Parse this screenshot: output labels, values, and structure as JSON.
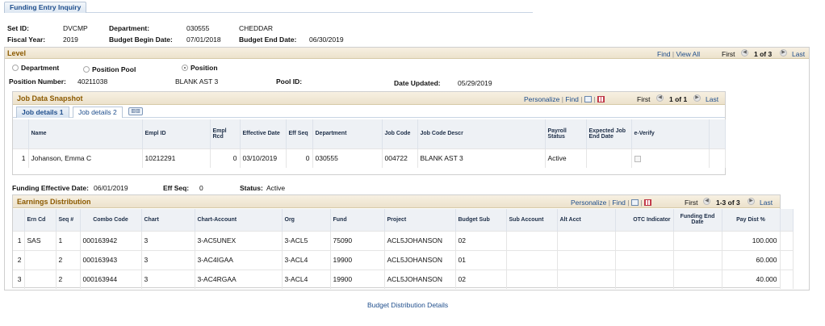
{
  "page_tab": "Funding Entry Inquiry",
  "header": {
    "set_id_label": "Set ID:",
    "set_id": "DVCMP",
    "department_label": "Department:",
    "department_code": "030555",
    "department_name": "CHEDDAR",
    "fiscal_year_label": "Fiscal Year:",
    "fiscal_year": "2019",
    "budget_begin_label": "Budget Begin Date:",
    "budget_begin": "07/01/2018",
    "budget_end_label": "Budget End Date:",
    "budget_end": "06/30/2019"
  },
  "level": {
    "title": "Level",
    "find": "Find",
    "view_all": "View All",
    "first": "First",
    "count": "1 of 3",
    "last": "Last",
    "radio_department": "Department",
    "radio_position_pool": "Position Pool",
    "radio_position": "Position",
    "position_number_label": "Position Number:",
    "position_number": "40211038",
    "position_title": "BLANK AST 3",
    "pool_id_label": "Pool ID:",
    "date_updated_label": "Date Updated:",
    "date_updated": "05/29/2019"
  },
  "job_snapshot": {
    "title": "Job Data Snapshot",
    "personalize": "Personalize",
    "find": "Find",
    "first": "First",
    "count": "1 of 1",
    "last": "Last",
    "tab1": "Job details 1",
    "tab2": "Job details 2",
    "columns": [
      "Name",
      "Empl ID",
      "Empl Rcd",
      "Effective Date",
      "Eff Seq",
      "Department",
      "Job Code",
      "Job Code Descr",
      "Payroll Status",
      "Expected Job End Date",
      "e-Verify"
    ],
    "row": {
      "num": "1",
      "name": "Johanson, Emma C",
      "emplid": "10212291",
      "rcd": "0",
      "eff_date": "03/10/2019",
      "eff_seq": "0",
      "dept": "030555",
      "jobcode": "004722",
      "descr": "BLANK AST 3",
      "status": "Active"
    }
  },
  "funding": {
    "eff_date_label": "Funding Effective Date:",
    "eff_date": "06/01/2019",
    "eff_seq_label": "Eff Seq:",
    "eff_seq": "0",
    "status_label": "Status:",
    "status": "Active"
  },
  "earnings": {
    "title": "Earnings Distribution",
    "personalize": "Personalize",
    "find": "Find",
    "first": "First",
    "count": "1-3 of 3",
    "last": "Last",
    "columns": [
      "Ern Cd",
      "Seq #",
      "Combo Code",
      "Chart",
      "Chart-Account",
      "Org",
      "Fund",
      "Project",
      "Budget Sub",
      "Sub Account",
      "Alt Acct",
      "OTC Indicator",
      "Funding End Date",
      "Pay Dist %"
    ],
    "rows": [
      {
        "num": "1",
        "ern": "SAS",
        "seq": "1",
        "combo": "000163942",
        "chart": "3",
        "acct": "3-AC5UNEX",
        "org": "3-ACL5",
        "fund": "75090",
        "project": "ACL5JOHANSON",
        "bsub": "02",
        "pct": "100.000"
      },
      {
        "num": "2",
        "ern": "",
        "seq": "2",
        "combo": "000163943",
        "chart": "3",
        "acct": "3-AC4IGAA",
        "org": "3-ACL4",
        "fund": "19900",
        "project": "ACL5JOHANSON",
        "bsub": "01",
        "pct": "60.000"
      },
      {
        "num": "3",
        "ern": "",
        "seq": "2",
        "combo": "000163944",
        "chart": "3",
        "acct": "3-AC4RGAA",
        "org": "3-ACL4",
        "fund": "19900",
        "project": "ACL5JOHANSON",
        "bsub": "02",
        "pct": "40.000"
      }
    ]
  },
  "footer_link": "Budget Distribution Details"
}
